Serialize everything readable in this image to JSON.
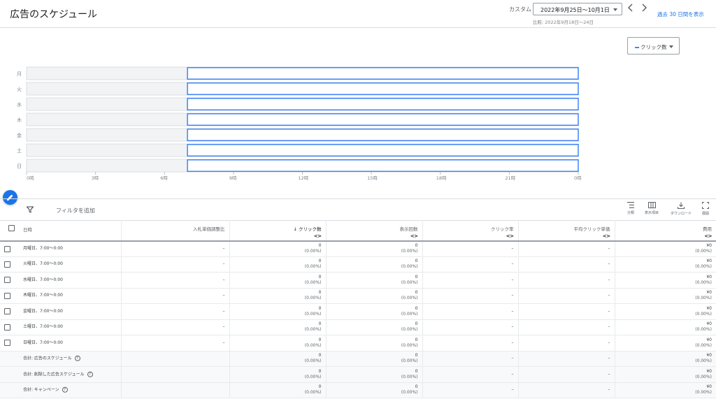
{
  "header": {
    "title": "広告のスケジュール",
    "range_label": "カスタム",
    "date_range": "2022年9月25日〜10月1日",
    "prev_icon": "chevron-left-icon",
    "next_icon": "chevron-right-icon",
    "compare": "比較: 2022年9月18日〜24日",
    "last30_link": "過去 30 日間を表示"
  },
  "chart": {
    "metric_label": "クリック数",
    "days": [
      "月",
      "火",
      "水",
      "木",
      "金",
      "土",
      "日"
    ],
    "hour_ticks": [
      "0時",
      "3時",
      "6時",
      "9時",
      "12時",
      "15時",
      "18時",
      "21時",
      "0時"
    ],
    "schedule_start_hour": 7,
    "schedule_end_hour": 24,
    "accent_color": "#4285f4"
  },
  "fab": {
    "icon": "pencil-icon"
  },
  "toolbar": {
    "filter_icon": "filter-icon",
    "filter_placeholder": "フィルタを追加",
    "segment_label": "分類",
    "columns_label": "表示項目",
    "download_label": "ダウンロード",
    "expand_label": "展開"
  },
  "table": {
    "headers": [
      "日時",
      "入札単価調整比",
      "クリック数",
      "表示回数",
      "クリック率",
      "平均クリック単価",
      "費用"
    ],
    "rows": [
      {
        "date": "月曜日、7:00〜0:00",
        "bid": "–",
        "clicks": "0",
        "clicks_pct": "(0.00%)",
        "impr": "0",
        "impr_pct": "(0.00%)",
        "ctr": "–",
        "cpc": "–",
        "cost": "¥0",
        "cost_pct": "(0.00%)"
      },
      {
        "date": "火曜日、7:00〜0:00",
        "bid": "–",
        "clicks": "0",
        "clicks_pct": "(0.00%)",
        "impr": "0",
        "impr_pct": "(0.00%)",
        "ctr": "–",
        "cpc": "–",
        "cost": "¥0",
        "cost_pct": "(0.00%)"
      },
      {
        "date": "水曜日、7:00〜0:00",
        "bid": "–",
        "clicks": "0",
        "clicks_pct": "(0.00%)",
        "impr": "0",
        "impr_pct": "(0.00%)",
        "ctr": "–",
        "cpc": "–",
        "cost": "¥0",
        "cost_pct": "(0.00%)"
      },
      {
        "date": "木曜日、7:00〜0:00",
        "bid": "–",
        "clicks": "0",
        "clicks_pct": "(0.00%)",
        "impr": "0",
        "impr_pct": "(0.00%)",
        "ctr": "–",
        "cpc": "–",
        "cost": "¥0",
        "cost_pct": "(0.00%)"
      },
      {
        "date": "金曜日、7:00〜0:00",
        "bid": "–",
        "clicks": "0",
        "clicks_pct": "(0.00%)",
        "impr": "0",
        "impr_pct": "(0.00%)",
        "ctr": "–",
        "cpc": "–",
        "cost": "¥0",
        "cost_pct": "(0.00%)"
      },
      {
        "date": "土曜日、7:00〜0:00",
        "bid": "–",
        "clicks": "0",
        "clicks_pct": "(0.00%)",
        "impr": "0",
        "impr_pct": "(0.00%)",
        "ctr": "–",
        "cpc": "–",
        "cost": "¥0",
        "cost_pct": "(0.00%)"
      },
      {
        "date": "日曜日、7:00〜0:00",
        "bid": "–",
        "clicks": "0",
        "clicks_pct": "(0.00%)",
        "impr": "0",
        "impr_pct": "(0.00%)",
        "ctr": "–",
        "cpc": "–",
        "cost": "¥0",
        "cost_pct": "(0.00%)"
      }
    ],
    "totals": [
      {
        "label": "合計: 広告のスケジュール",
        "clicks": "0",
        "clicks_pct": "(0.00%)",
        "impr": "0",
        "impr_pct": "(0.00%)",
        "ctr": "–",
        "cpc": "–",
        "cost": "¥0",
        "cost_pct": "(0.00%)"
      },
      {
        "label": "合計: 削除した広告スケジュール",
        "clicks": "0",
        "clicks_pct": "(0.00%)",
        "impr": "0",
        "impr_pct": "(0.00%)",
        "ctr": "–",
        "cpc": "–",
        "cost": "¥0",
        "cost_pct": "(0.00%)"
      },
      {
        "label": "合計: キャンペーン",
        "clicks": "0",
        "clicks_pct": "(0.00%)",
        "impr": "0",
        "impr_pct": "(0.00%)",
        "ctr": "–",
        "cpc": "–",
        "cost": "¥0",
        "cost_pct": "(0.00%)"
      }
    ]
  }
}
